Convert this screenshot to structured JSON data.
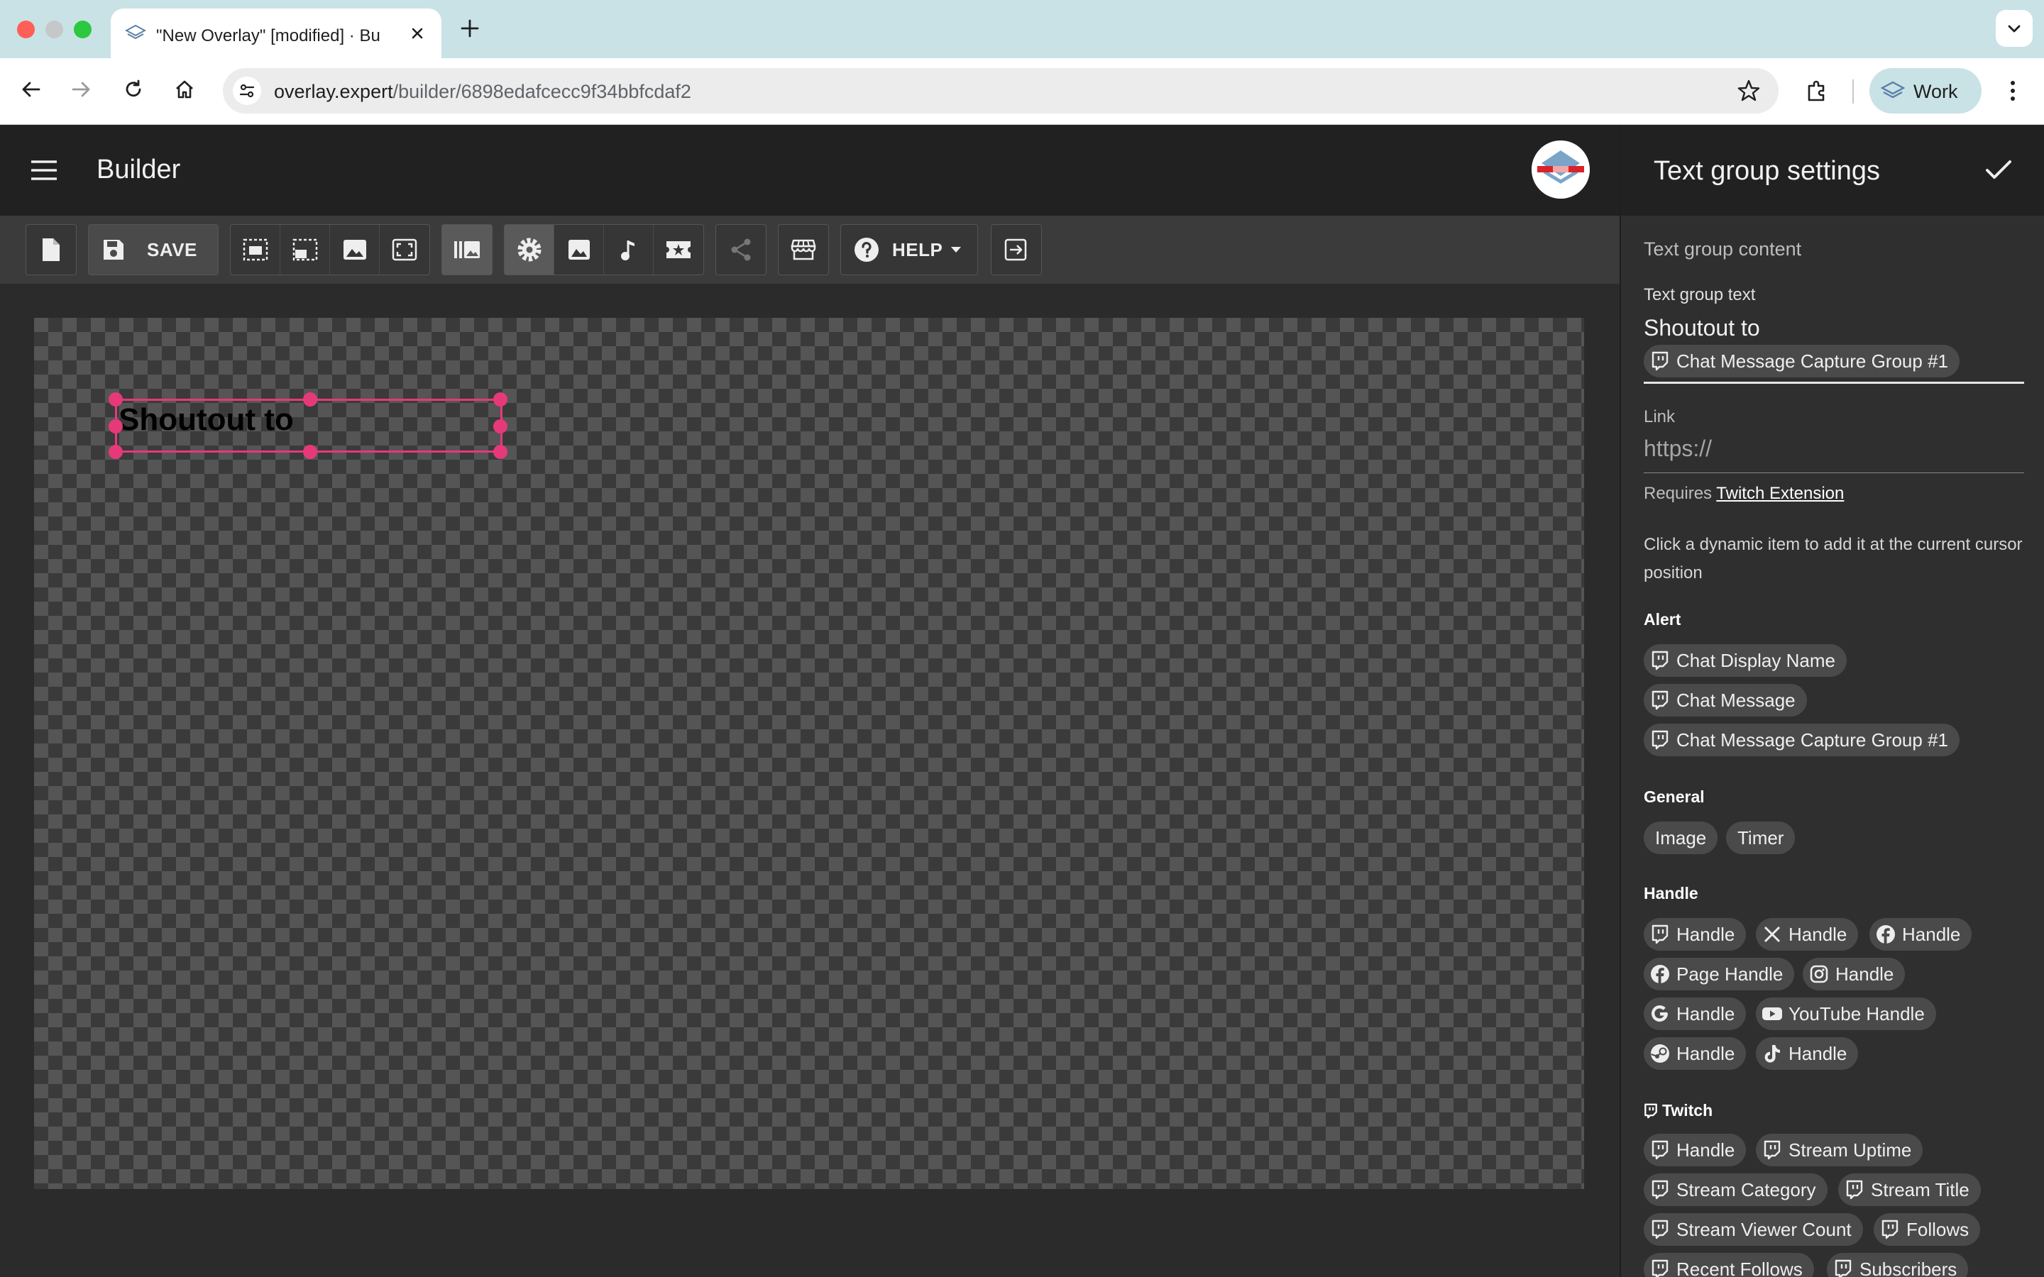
{
  "browser": {
    "tab_title": "\"New Overlay\" [modified] · Bu",
    "url_host": "overlay.expert",
    "url_path": "/builder/6898edafcecc9f34bbfcdaf2",
    "profile_name": "Work"
  },
  "app": {
    "title": "Builder",
    "save_label": "SAVE",
    "help_label": "HELP"
  },
  "canvas": {
    "text_element": "Shoutout to"
  },
  "panel": {
    "title": "Text group settings",
    "content_section": "Text group content",
    "text_label": "Text group text",
    "text_value": "Shoutout to",
    "text_chip": "Chat Message Capture Group #1",
    "link_label": "Link",
    "link_placeholder": "https://",
    "requires_prefix": "Requires",
    "requires_link": "Twitch Extension",
    "hint": "Click a dynamic item to add it at the current cursor position",
    "groups": {
      "alert": {
        "title": "Alert",
        "items": [
          "Chat Display Name",
          "Chat Message",
          "Chat Message Capture Group #1"
        ]
      },
      "general": {
        "title": "General",
        "items": [
          "Image",
          "Timer"
        ]
      },
      "handle": {
        "title": "Handle",
        "items": [
          "Handle",
          "Handle",
          "Handle",
          "Page Handle",
          "Handle",
          "Handle",
          "YouTube Handle",
          "Handle",
          "Handle"
        ],
        "icons": [
          "twitch-icon",
          "x-icon",
          "facebook-icon",
          "facebook-icon",
          "instagram-icon",
          "google-icon",
          "youtube-icon",
          "steam-icon",
          "tiktok-icon"
        ]
      },
      "twitch": {
        "title": "Twitch",
        "items": [
          "Handle",
          "Stream Uptime",
          "Stream Category",
          "Stream Title",
          "Stream Viewer Count",
          "Follows",
          "Recent Follows",
          "Subscribers"
        ]
      }
    }
  },
  "colors": {
    "selection": "#e6397a",
    "header_bg": "#212121",
    "panel_bg": "#2f2f2f"
  }
}
